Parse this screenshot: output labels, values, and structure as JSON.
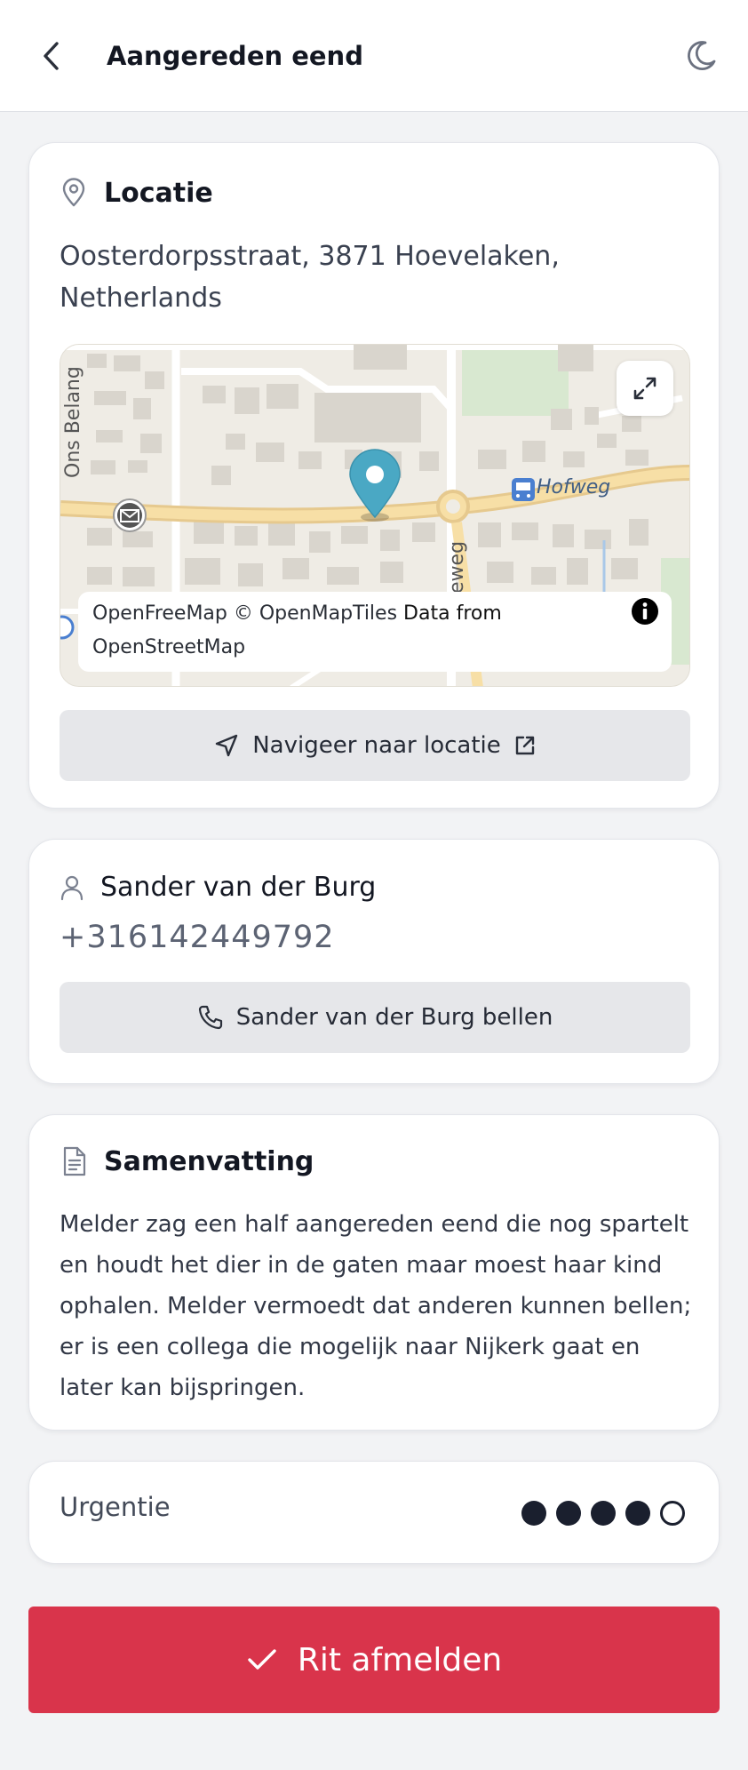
{
  "header": {
    "title": "Aangereden eend"
  },
  "location": {
    "title": "Locatie",
    "address": "Oosterdorpsstraat, 3871 Hoevelaken, Netherlands",
    "map": {
      "labels": {
        "hofweg": "Hofweg",
        "ons_belang": "Ons Belang",
        "weg": "eweg"
      },
      "attribution": {
        "openfreemap": "OpenFreeMap",
        "openmaptiles": "© OpenMapTiles",
        "data_from": "Data from",
        "openstreetmap": "OpenStreetMap"
      },
      "marker_color": "#4aa8c4"
    },
    "navigate_label": "Navigeer naar locatie"
  },
  "contact": {
    "name": "Sander van der Burg",
    "phone": "+316142449792",
    "call_label": "Sander van der Burg bellen"
  },
  "summary": {
    "title": "Samenvatting",
    "text": "Melder zag een half aangereden eend die nog spartelt en houdt het dier in de gaten maar moest haar kind ophalen. Melder vermoedt dat anderen kunnen bellen; er is een collega die mogelijk naar Nijkerk gaat en later kan bijspringen."
  },
  "urgency": {
    "label": "Urgentie",
    "level": 4,
    "max": 5
  },
  "actions": {
    "complete_label": "Rit afmelden"
  },
  "colors": {
    "accent": "#d9344b",
    "background": "#f2f3f5"
  }
}
